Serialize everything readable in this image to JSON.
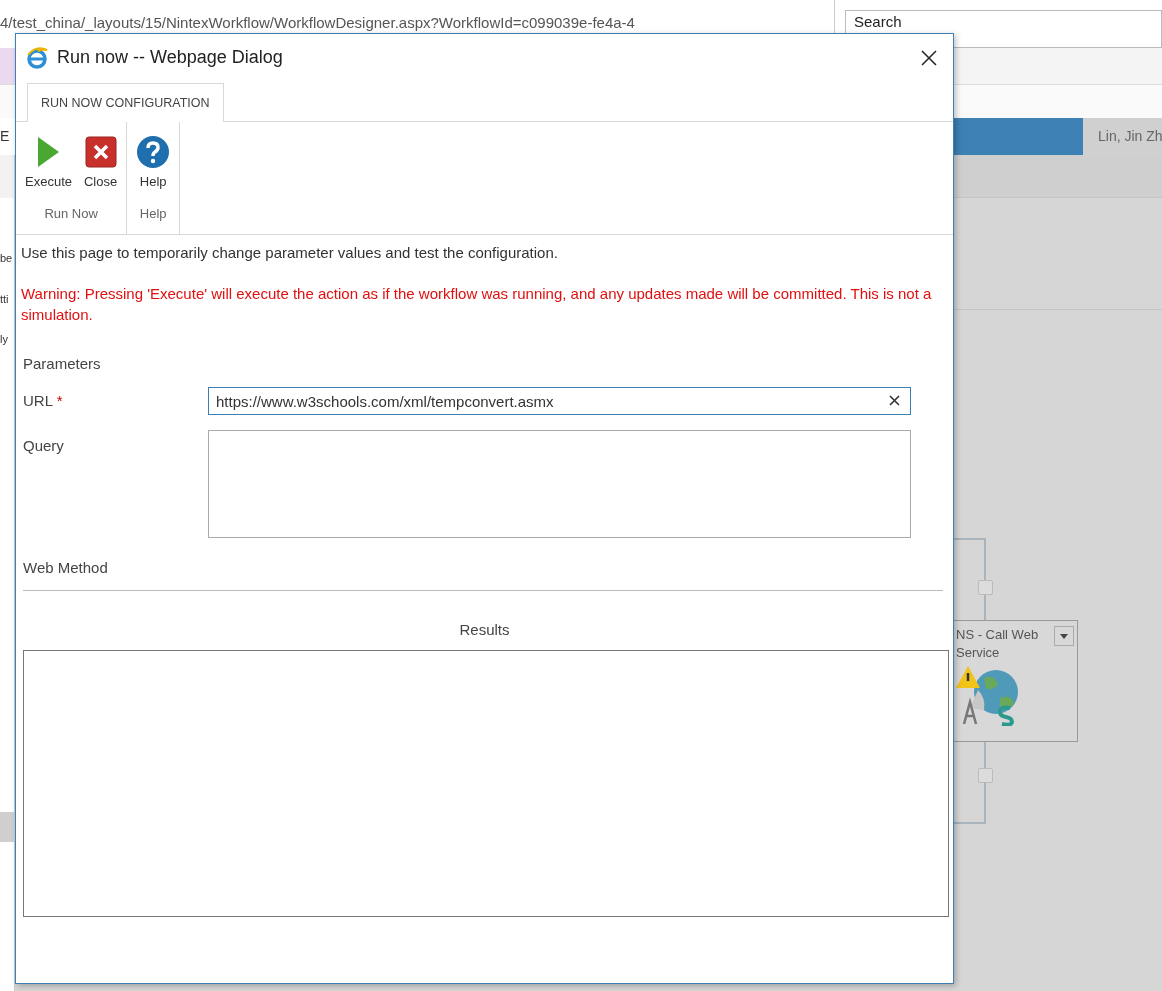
{
  "browser": {
    "address": "4/test_china/_layouts/15/NintexWorkflow/WorkflowDesigner.aspx?WorkflowId=c099039e-fe4a-4",
    "search": {
      "placeholder": "Search"
    }
  },
  "page": {
    "user_name": "Lin, Jin Zh",
    "left_fragments": [
      "E",
      "be",
      "tti",
      "ly"
    ],
    "workflow_action": {
      "title": "NS - Call Web Service"
    }
  },
  "dialog": {
    "title": "Run now -- Webpage Dialog",
    "tabs": [
      {
        "label": "RUN NOW CONFIGURATION",
        "selected": true
      }
    ],
    "ribbon_groups": [
      {
        "label": "Run Now",
        "buttons": [
          {
            "label": "Execute",
            "kind": "execute"
          },
          {
            "label": "Close",
            "kind": "close"
          }
        ]
      },
      {
        "label": "Help",
        "buttons": [
          {
            "label": "Help",
            "kind": "help"
          }
        ]
      }
    ],
    "intro": "Use this page to temporarily change parameter values and test the configuration.",
    "warning": "Warning: Pressing 'Execute' will execute the action as if the workflow was running, and any updates made will be committed. This is not a simulation.",
    "section": "Parameters",
    "fields": [
      {
        "label": "URL",
        "required_mark": "*",
        "kind": "text",
        "value": "https://www.w3schools.com/xml/tempconvert.asmx"
      },
      {
        "label": "Query",
        "kind": "textarea"
      },
      {
        "label": "Web Method",
        "kind": "heading"
      }
    ],
    "results": {
      "label": "Results"
    }
  }
}
